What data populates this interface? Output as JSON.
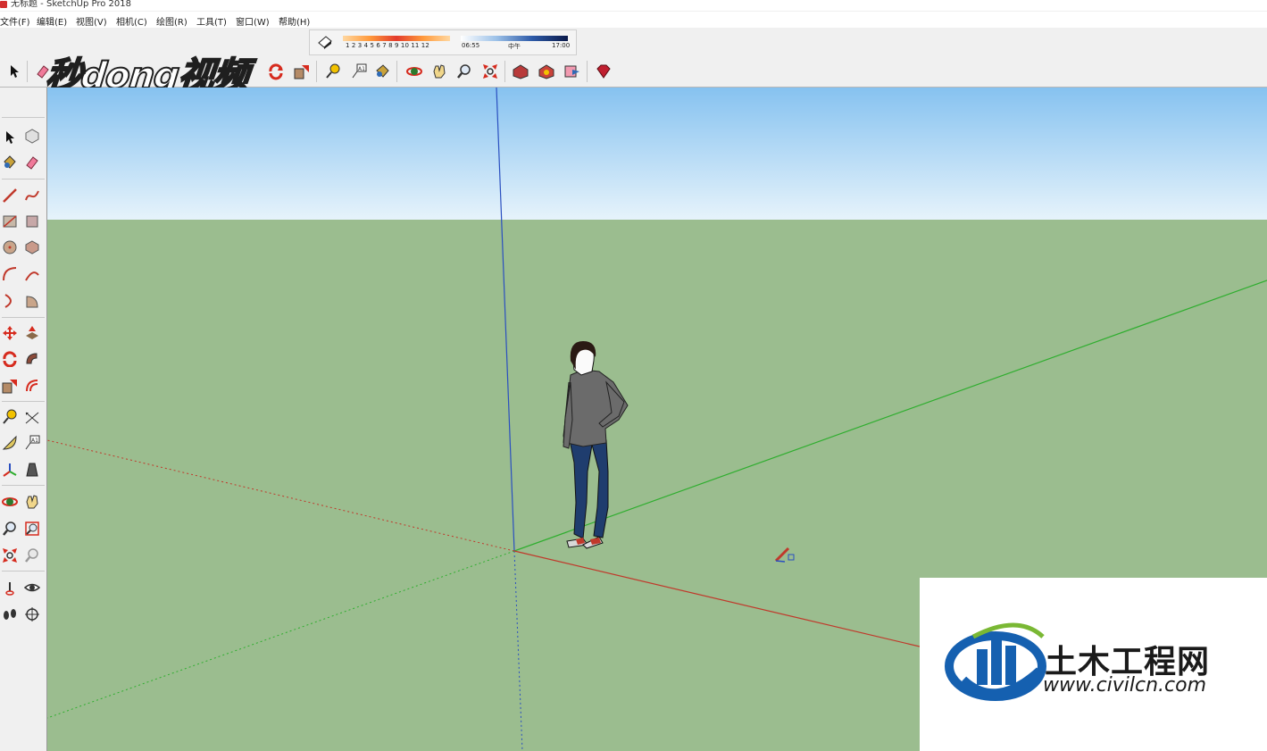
{
  "window": {
    "title": "无标题 - SketchUp Pro 2018"
  },
  "menu": {
    "items": [
      "文件(F)",
      "编辑(E)",
      "视图(V)",
      "相机(C)",
      "绘图(R)",
      "工具(T)",
      "窗口(W)",
      "帮助(H)"
    ]
  },
  "shadows": {
    "months": "1 2 3 4 5 6 7 8 9 10 11 12",
    "time_start": "06:55",
    "time_mid": "中午",
    "time_end": "17:00"
  },
  "watermarks": {
    "top_left": "秒dong视频",
    "bottom_right_title": "土木工程网",
    "bottom_right_url": "www.civilcn.com"
  },
  "colors": {
    "sky_top": "#86c2f0",
    "sky_bottom": "#e6f3fb",
    "ground": "#9bbd8f",
    "axis_red": "#c0392b",
    "axis_green": "#2fae2f",
    "axis_blue": "#2a4fc0",
    "civil_blue": "#1560b0"
  },
  "icons": {
    "top_toolbar": [
      "select-icon",
      "eraser-icon",
      "rotate-icon",
      "scale-icon",
      "tape-measure-icon",
      "text-icon",
      "paint-bucket-icon",
      "orbit-icon",
      "pan-icon",
      "zoom-icon",
      "zoom-extents-icon",
      "warehouse-icon",
      "extension-warehouse-icon",
      "send-to-layout-icon",
      "ruby-icon"
    ],
    "left_toolbar": [
      "select-icon",
      "component-icon",
      "paint-bucket-icon",
      "eraser-icon",
      "line-icon",
      "freehand-icon",
      "rectangle-icon",
      "rotated-rectangle-icon",
      "circle-icon",
      "polygon-icon",
      "arc-icon",
      "two-point-arc-icon",
      "three-point-arc-icon",
      "pie-icon",
      "move-icon",
      "push-pull-icon",
      "rotate-icon",
      "follow-me-icon",
      "scale-icon",
      "offset-icon",
      "tape-measure-icon",
      "dimension-icon",
      "protractor-icon",
      "text-icon",
      "axes-icon",
      "3d-text-icon",
      "orbit-icon",
      "pan-icon",
      "zoom-icon",
      "zoom-window-icon",
      "zoom-extents-icon",
      "previous-view-icon",
      "position-camera-icon",
      "look-around-icon",
      "walk-icon",
      "section-plane-icon"
    ]
  }
}
